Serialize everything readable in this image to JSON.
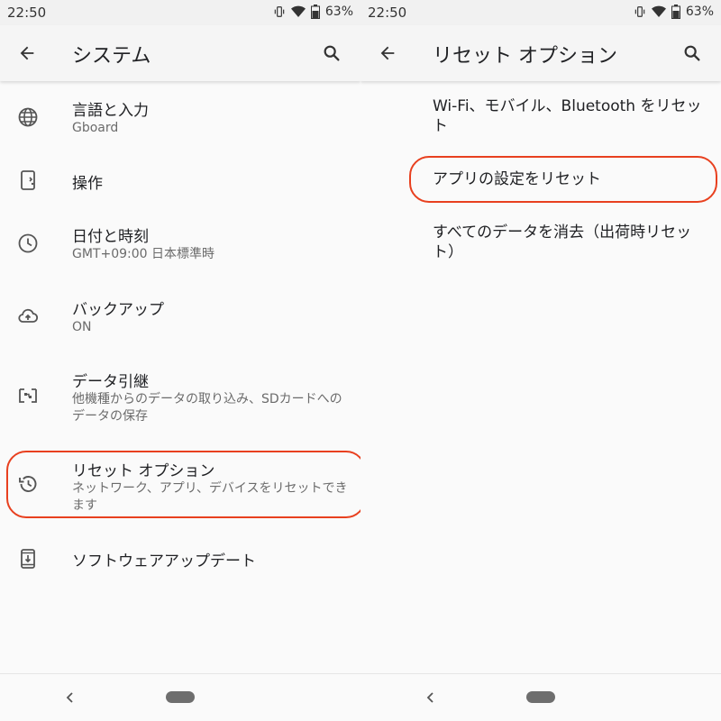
{
  "status": {
    "time": "22:50",
    "battery": "63%"
  },
  "left": {
    "title": "システム",
    "items": [
      {
        "title": "言語と入力",
        "subtitle": "Gboard"
      },
      {
        "title": "操作"
      },
      {
        "title": "日付と時刻",
        "subtitle": "GMT+09:00 日本標準時"
      },
      {
        "title": "バックアップ",
        "subtitle": "ON"
      },
      {
        "title": "データ引継",
        "subtitle": "他機種からのデータの取り込み、SDカードへのデータの保存"
      },
      {
        "title": "リセット オプション",
        "subtitle": "ネットワーク、アプリ、デバイスをリセットできます"
      },
      {
        "title": "ソフトウェアアップデート"
      }
    ]
  },
  "right": {
    "title": "リセット オプション",
    "items": [
      {
        "title": "Wi-Fi、モバイル、Bluetooth をリセット"
      },
      {
        "title": "アプリの設定をリセット"
      },
      {
        "title": "すべてのデータを消去（出荷時リセット）"
      }
    ]
  },
  "icons": {
    "back": "arrow-left-icon",
    "search": "search-icon",
    "language": "globe-icon",
    "gesture": "phone-gesture-icon",
    "clock": "clock-icon",
    "backup": "cloud-upload-icon",
    "transfer": "data-transfer-icon",
    "reset": "history-icon",
    "update": "system-update-icon",
    "nav_back": "chevron-left-icon"
  },
  "colors": {
    "highlight": "#e8401f",
    "background": "#fafafa",
    "appbar": "#f5f5f5"
  }
}
